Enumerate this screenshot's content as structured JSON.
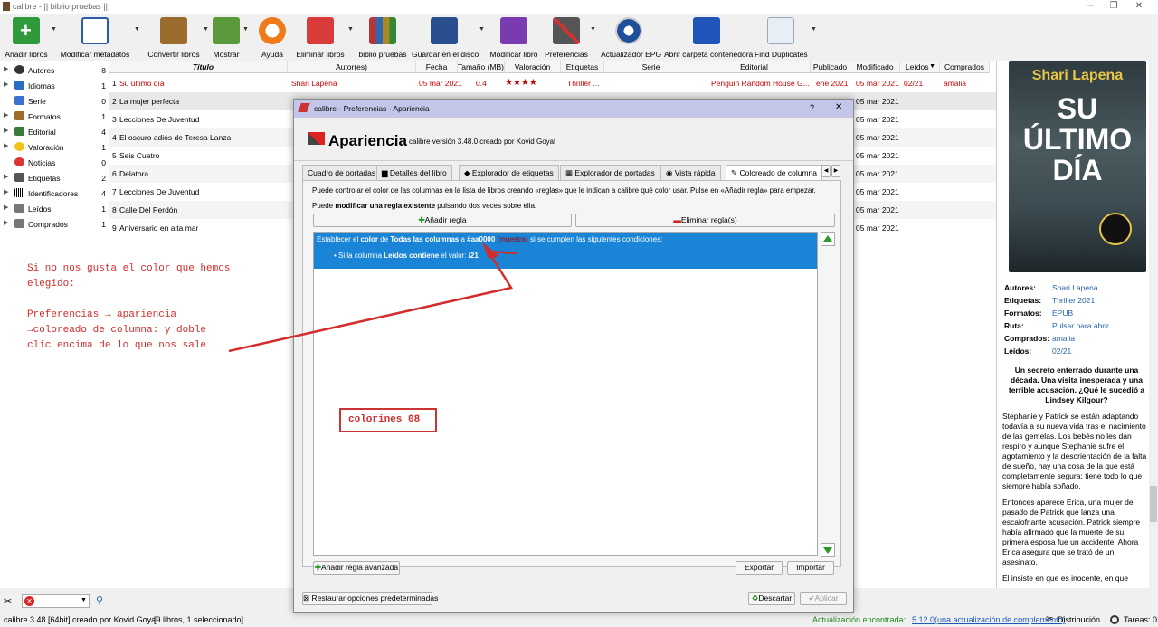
{
  "window": {
    "title": "calibre - || biblio pruebas ||"
  },
  "toolbar": {
    "add": "Añadir libros",
    "edit_meta": "Modificar metadatos",
    "convert": "Convertir libros",
    "view": "Mostrar",
    "help": "Ayuda",
    "remove": "Eliminar libros",
    "library": "biblio pruebas",
    "save": "Guardar en el disco",
    "edit_book": "Modificar libro",
    "prefs": "Preferencias",
    "epg": "Actualizador EPG",
    "open_folder": "Abrir carpeta contenedora",
    "find_dup": "Find Duplicates"
  },
  "tag_browser": [
    {
      "name": "Autores",
      "count": "8"
    },
    {
      "name": "Idiomas",
      "count": "1"
    },
    {
      "name": "Serie",
      "count": "0"
    },
    {
      "name": "Formatos",
      "count": "1"
    },
    {
      "name": "Editorial",
      "count": "4"
    },
    {
      "name": "Valoración",
      "count": "1"
    },
    {
      "name": "Noticias",
      "count": "0"
    },
    {
      "name": "Etiquetas",
      "count": "2"
    },
    {
      "name": "Identificadores",
      "count": "4"
    },
    {
      "name": "Leídos",
      "count": "1"
    },
    {
      "name": "Comprados",
      "count": "1"
    }
  ],
  "columns": {
    "title": "Título",
    "authors": "Autor(es)",
    "date": "Fecha",
    "size": "Tamaño (MB)",
    "rating": "Valoración",
    "tags": "Etiquetas",
    "series": "Serie",
    "publisher": "Editorial",
    "published": "Publicado",
    "modified": "Modificado",
    "read": "Leídos",
    "read_sort": "▼",
    "bought": "Comprados"
  },
  "books": [
    {
      "n": "1",
      "title": "Su último día",
      "author": "Shari Lapena",
      "date": "05 mar 2021",
      "size": "0.4",
      "rating": "★★★★",
      "tags": "Thriller ...",
      "publisher": "Penguin Random House G...",
      "published": "ene 2021",
      "modified": "05 mar 2021",
      "read": "02/21",
      "bought": "amalia"
    },
    {
      "n": "2",
      "title": "La mujer perfecta",
      "modified": "05 mar 2021"
    },
    {
      "n": "3",
      "title": "Lecciones De Juventud",
      "modified": "05 mar 2021"
    },
    {
      "n": "4",
      "title": "El oscuro adiós de Teresa Lanza",
      "modified": "05 mar 2021"
    },
    {
      "n": "5",
      "title": "Seis Cuatro",
      "modified": "05 mar 2021"
    },
    {
      "n": "6",
      "title": "Delatora",
      "modified": "05 mar 2021"
    },
    {
      "n": "7",
      "title": "Lecciones De Juventud",
      "modified": "05 mar 2021"
    },
    {
      "n": "8",
      "title": "Calle Del Perdón",
      "modified": "05 mar 2021"
    },
    {
      "n": "9",
      "title": "Aniversario en alta mar",
      "modified": "05 mar 2021"
    }
  ],
  "cover": {
    "author": "Shari Lapena",
    "title": "SU ÚLTIMO DÍA"
  },
  "details": {
    "authors_label": "Autores:",
    "authors": "Shari Lapena",
    "tags_label": "Etiquetas:",
    "tags": "Thriller 2021",
    "formats_label": "Formatos:",
    "formats": "EPUB",
    "path_label": "Ruta:",
    "path": "Pulsar para abrir",
    "bought_label": "Comprados:",
    "bought": "amalia",
    "read_label": "Leídos:",
    "read": "02/21",
    "desc_bold": "Un secreto enterrado durante una década. Una visita inesperada y una terrible acusación. ¿Qué le sucedió a Lindsey Kilgour?",
    "desc_p1": "Stephanie y Patrick se están adaptando todavía a su nueva vida tras el nacimiento de las gemelas. Los bebés no les dan respiro y aunque Stephanie sufre el agotamiento y la desorientación de la falta de sueño, hay una cosa de la que está completamente segura: tiene todo lo que siempre había soñado.",
    "desc_p2": "Entonces aparece Erica, una mujer del pasado de Patrick que lanza una escalofriante acusación. Patrick siempre había afirmado que la muerte de su primera esposa fue un accidente. Ahora Erica asegura que se trató de un asesinato.",
    "desc_p3": "Él insiste en que es inocente, en que"
  },
  "status": {
    "left": "calibre 3.48 [64bit] creado por Kovid Goyal",
    "count": "[9 libros, 1 seleccionado]",
    "update_label": "Actualización encontrada:",
    "update_link": "5.12.0(una actualización de complemento)",
    "distrib": "Distribución",
    "tasks": "Tareas: 0"
  },
  "dialog": {
    "title": "calibre - Preferencias - Apariencia",
    "help": "?",
    "close": "✕",
    "heading": "Apariencia",
    "version": "calibre versión 3.48.0 creado por Kovid Goyal",
    "tabs": [
      "Cuadro de portadas",
      "Detalles del libro",
      "Explorador de etiquetas",
      "Explorador de portadas",
      "Vista rápida",
      "Coloreado de columna"
    ],
    "tab_prev": "◀",
    "tab_next": "▶",
    "intro": "Puede controlar el color de las columnas en la lista de libros creando «reglas» que le indican a calibre qué color usar. Pulse en «Añadir regla» para empezar.",
    "edit_hint_pre": "Puede ",
    "edit_hint_bold": "modificar una regla existente",
    "edit_hint_post": " pulsando dos veces sobre ella.",
    "add_rule": "Añadir regla",
    "remove_rule": "Eliminar regla(s)",
    "rule_line1_a": "Establecer el ",
    "rule_line1_b": "color",
    "rule_line1_c": " de ",
    "rule_line1_d": "Todas las columnas",
    "rule_line1_e": " a ",
    "rule_line1_f": "#aa0000",
    "rule_line1_g": " (muestra)",
    "rule_line1_h": " si se cumplen las siguientes condiciones:",
    "rule_line2_a": "Si la columna ",
    "rule_line2_b": "Leídos contiene",
    "rule_line2_c": " el valor: ",
    "rule_line2_d": "/21",
    "adv_rule": "Añadir regla avanzada",
    "export": "Exportar",
    "import": "Importar",
    "restore": "Restaurar opciones predeterminadas",
    "discard": "Descartar",
    "apply": "Aplicar"
  },
  "annotation": {
    "text": "Si no nos gusta el color que hemos\nelegido:\n\nPreferencias → apariencia\n→coloreado de columna: y doble\nclic encima de lo que nos sale",
    "box": "colorines 08",
    "color": "#d32c2c"
  }
}
